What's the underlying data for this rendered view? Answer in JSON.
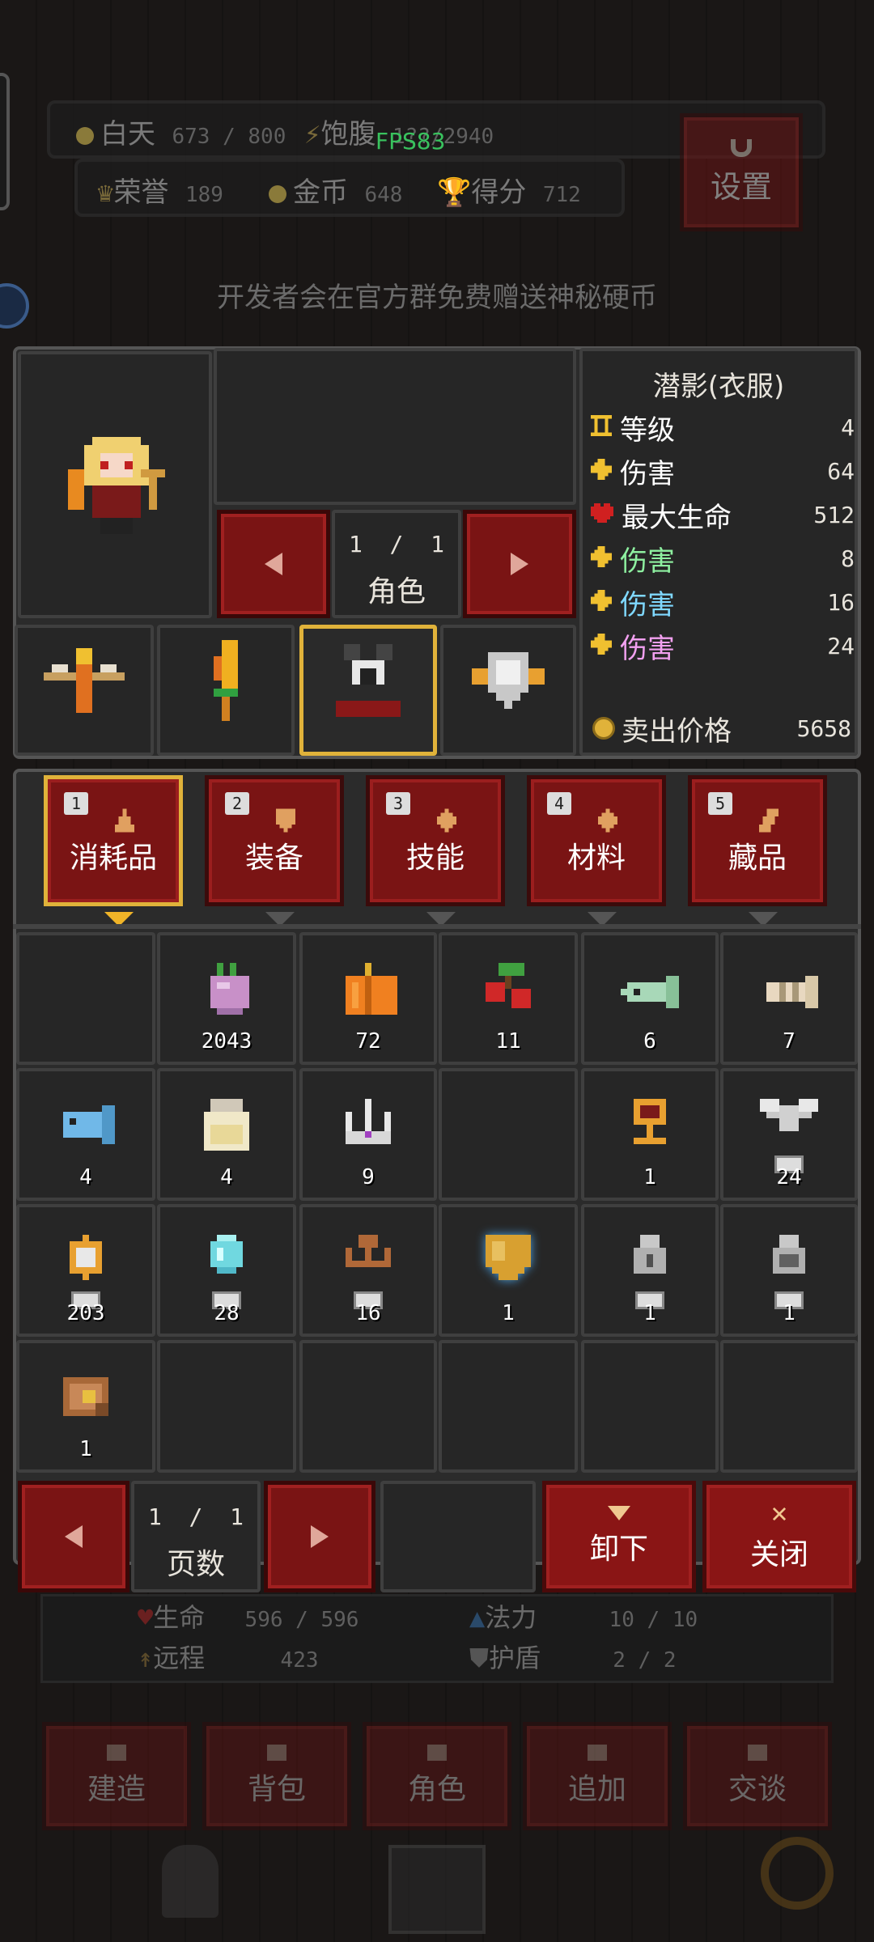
{
  "hud": {
    "day_label": "白天",
    "day_value": "673 / 800",
    "satiety_label": "饱腹",
    "satiety_value": "1??/2940",
    "fps": "FPS83",
    "honor_label": "荣誉",
    "honor_value": "189",
    "gold_label": "金币",
    "gold_value": "648",
    "score_label": "得分",
    "score_value": "712",
    "settings_label": "设置",
    "banner": "开发者会在官方群免费赠送神秘硬币"
  },
  "character": {
    "page": "1  /  1",
    "page_label": "角色"
  },
  "item_detail": {
    "title": "潜影(衣服)",
    "stats": [
      {
        "label": "等级",
        "value": "4",
        "color": "#ffffff",
        "icon": "level-icon"
      },
      {
        "label": "伤害",
        "value": "64",
        "color": "#ffffff",
        "icon": "damage-icon"
      },
      {
        "label": "最大生命",
        "value": "512",
        "color": "#ffffff",
        "icon": "heart-icon"
      },
      {
        "label": "伤害",
        "value": "8",
        "color": "#8ef0a0",
        "icon": "damage-icon"
      },
      {
        "label": "伤害",
        "value": "16",
        "color": "#7fd8ff",
        "icon": "damage-icon"
      },
      {
        "label": "伤害",
        "value": "24",
        "color": "#f2a0f0",
        "icon": "damage-icon"
      }
    ],
    "sell_label": "卖出价格",
    "sell_value": "5658"
  },
  "tabs": [
    {
      "num": "1",
      "label": "消耗品",
      "selected": true
    },
    {
      "num": "2",
      "label": "装备",
      "selected": false
    },
    {
      "num": "3",
      "label": "技能",
      "selected": false
    },
    {
      "num": "4",
      "label": "材料",
      "selected": false
    },
    {
      "num": "5",
      "label": "藏品",
      "selected": false
    }
  ],
  "inventory": [
    {
      "icon": "",
      "qty": ""
    },
    {
      "icon": "turnip-icon",
      "qty": "2043"
    },
    {
      "icon": "pumpkin-icon",
      "qty": "72"
    },
    {
      "icon": "cherry-icon",
      "qty": "11"
    },
    {
      "icon": "fish-green-icon",
      "qty": "6"
    },
    {
      "icon": "fish-bone-icon",
      "qty": "7"
    },
    {
      "icon": "fish-blue-icon",
      "qty": "4"
    },
    {
      "icon": "jar-icon",
      "qty": "4"
    },
    {
      "icon": "crown-icon",
      "qty": "9"
    },
    {
      "icon": "",
      "qty": ""
    },
    {
      "icon": "goblet-icon",
      "qty": "1"
    },
    {
      "icon": "winged-statue-icon",
      "qty": "24"
    },
    {
      "icon": "orb-statue-icon",
      "qty": "203"
    },
    {
      "icon": "crystal-statue-icon",
      "qty": "28"
    },
    {
      "icon": "anchor-statue-icon",
      "qty": "16"
    },
    {
      "icon": "shield-icon",
      "qty": "1"
    },
    {
      "icon": "grey-idol-icon",
      "qty": "1"
    },
    {
      "icon": "grey-idol-2-icon",
      "qty": "1"
    },
    {
      "icon": "treasure-map-icon",
      "qty": "1"
    },
    {
      "icon": "",
      "qty": ""
    },
    {
      "icon": "",
      "qty": ""
    },
    {
      "icon": "",
      "qty": ""
    },
    {
      "icon": "",
      "qty": ""
    },
    {
      "icon": "",
      "qty": ""
    }
  ],
  "pager": {
    "page": "1  /  1",
    "page_label": "页数",
    "unequip_label": "卸下",
    "close_label": "关闭"
  },
  "under_stats": {
    "hp_label": "生命",
    "hp_value": "596 / 596",
    "mp_label": "法力",
    "mp_value": "10 / 10",
    "range_label": "远程",
    "range_value": "423",
    "armor_label": "护盾",
    "armor_value": "2  /  2"
  },
  "bottom_nav": [
    "建造",
    "背包",
    "角色",
    "追加",
    "交谈"
  ]
}
